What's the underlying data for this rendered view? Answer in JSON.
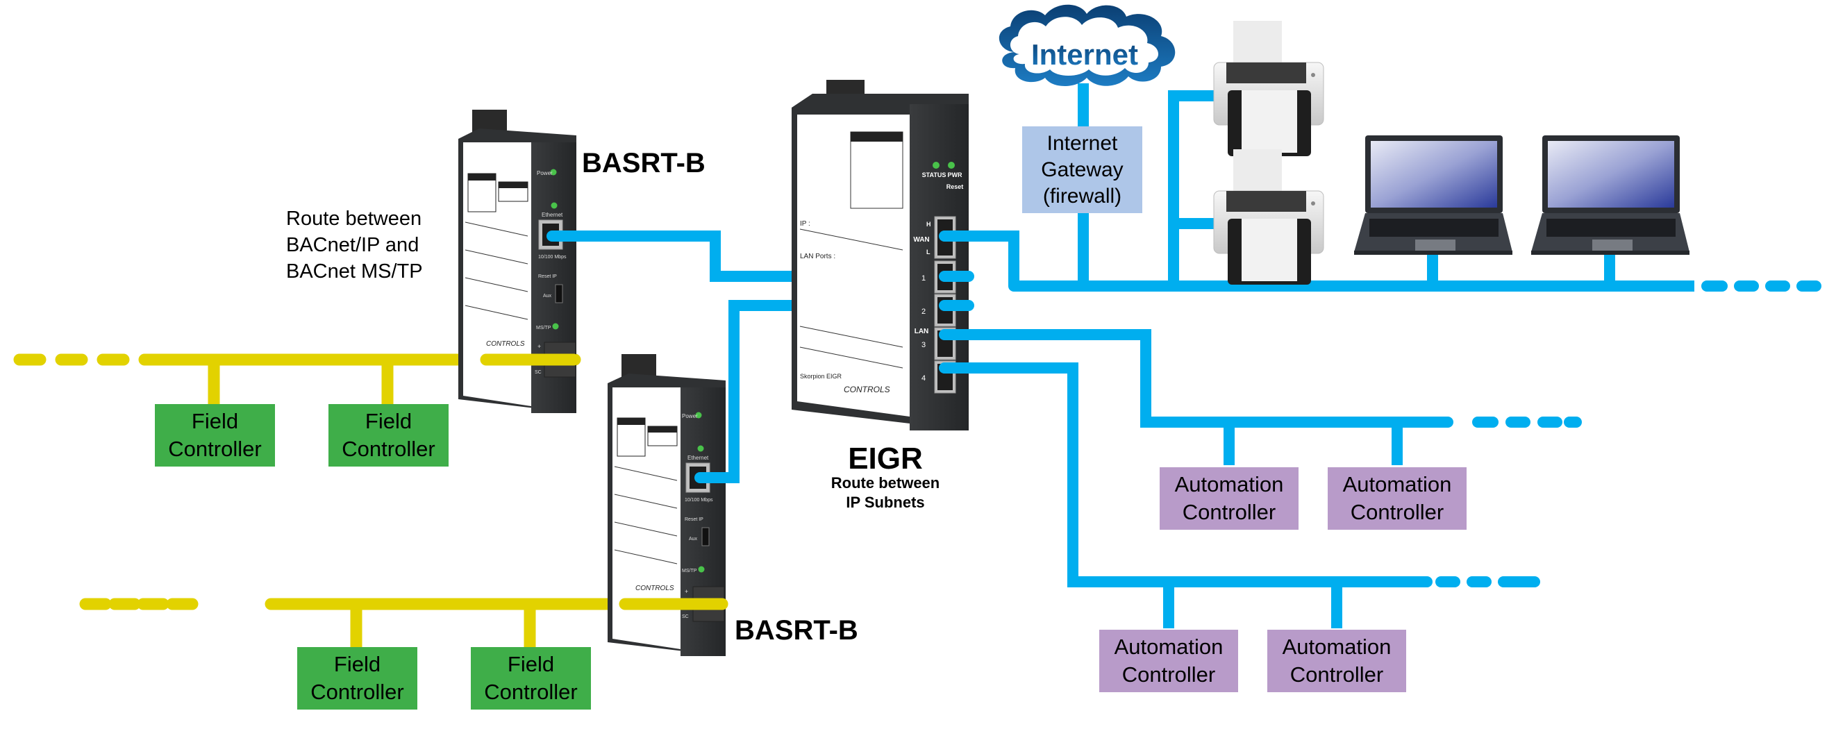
{
  "diagram": {
    "colors": {
      "ip_network": "#00aeef",
      "mstp_network": "#e2d200",
      "field_controller": "#3fae49",
      "automation_controller": "#b89bc9",
      "gateway": "#aec6e8",
      "device_body": "#2f3133",
      "cloud_dark": "#0b3f73",
      "cloud_light": "#1d7cc3"
    },
    "internet": {
      "label": "Internet",
      "icon": "cloud-icon"
    },
    "gateway": {
      "line1": "Internet",
      "line2": "Gateway",
      "line3": "(firewall)"
    },
    "printers": [
      {
        "icon": "printer-icon"
      },
      {
        "icon": "printer-icon"
      }
    ],
    "laptops": [
      {
        "icon": "laptop-icon"
      },
      {
        "icon": "laptop-icon"
      }
    ],
    "eigr": {
      "name": "EIGR",
      "desc_line1": "Route between",
      "desc_line2": "IP Subnets",
      "leds": [
        "STATUS",
        "PWR"
      ],
      "reset": "Reset",
      "wan_label": "WAN",
      "wan_h": "H",
      "wan_l": "L",
      "lan_label": "LAN",
      "lan_ports": [
        "1",
        "2",
        "3",
        "4"
      ],
      "label_ip": "IP :",
      "label_lan_ports": "LAN Ports :",
      "brand": "CONTROLS",
      "model_text": "Skorpion EIGR"
    },
    "basrt_top": {
      "name": "BASRT-B",
      "desc_line1": "Route between",
      "desc_line2": "BACnet/IP and",
      "desc_line3": "BACnet MS/TP",
      "power": "Power",
      "ethernet": "Ethernet",
      "speed": "10/100 Mbps",
      "reset_ip": "Reset IP",
      "aux": "Aux",
      "mstp": "MS/TP",
      "plus": "+",
      "sc": "SC",
      "brand": "CONTROLS"
    },
    "basrt_bottom": {
      "name": "BASRT-B",
      "power": "Power",
      "ethernet": "Ethernet",
      "speed": "10/100 Mbps",
      "reset_ip": "Reset IP",
      "aux": "Aux",
      "mstp": "MS/TP",
      "plus": "+",
      "sc": "SC",
      "brand": "CONTROLS"
    },
    "field_controllers_top": [
      {
        "line1": "Field",
        "line2": "Controller"
      },
      {
        "line1": "Field",
        "line2": "Controller"
      }
    ],
    "field_controllers_bottom": [
      {
        "line1": "Field",
        "line2": "Controller"
      },
      {
        "line1": "Field",
        "line2": "Controller"
      }
    ],
    "automation_controllers_upper": [
      {
        "line1": "Automation",
        "line2": "Controller"
      },
      {
        "line1": "Automation",
        "line2": "Controller"
      }
    ],
    "automation_controllers_lower": [
      {
        "line1": "Automation",
        "line2": "Controller"
      },
      {
        "line1": "Automation",
        "line2": "Controller"
      }
    ]
  }
}
